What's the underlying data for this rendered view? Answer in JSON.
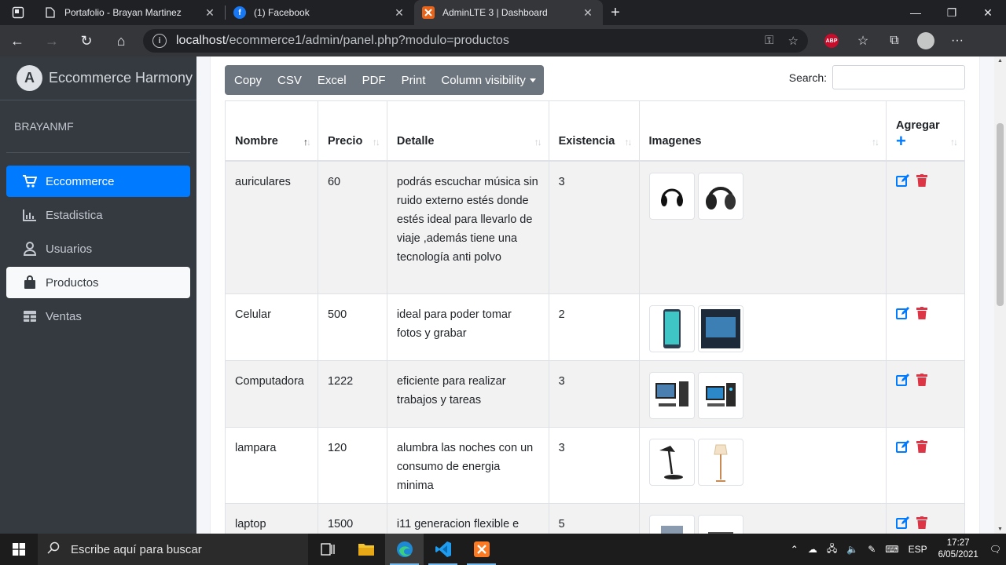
{
  "browser": {
    "tabs": [
      {
        "title": "Portafolio - Brayan Martinez",
        "active": false
      },
      {
        "title": "(1) Facebook",
        "active": false
      },
      {
        "title": "AdminLTE 3 | Dashboard",
        "active": true
      }
    ],
    "url_host": "localhost",
    "url_path": "/ecommerce1/admin/panel.php?modulo=productos",
    "abp_label": "ABP"
  },
  "sidebar": {
    "brand": "Eccommerce Harmony",
    "user": "BRAYANMF",
    "items": [
      {
        "label": "Eccommerce",
        "icon": "cart-icon",
        "state": "primary"
      },
      {
        "label": "Estadistica",
        "icon": "chart-icon",
        "state": "normal"
      },
      {
        "label": "Usuarios",
        "icon": "user-icon",
        "state": "normal"
      },
      {
        "label": "Productos",
        "icon": "bag-icon",
        "state": "light"
      },
      {
        "label": "Ventas",
        "icon": "table-icon",
        "state": "normal"
      }
    ]
  },
  "toolbar": {
    "buttons": [
      "Copy",
      "CSV",
      "Excel",
      "PDF",
      "Print",
      "Column visibility"
    ],
    "search_label": "Search:"
  },
  "table": {
    "headers": [
      "Nombre",
      "Precio",
      "Detalle",
      "Existencia",
      "Imagenes",
      "Agregar"
    ],
    "rows": [
      {
        "nombre": "auriculares",
        "precio": "60",
        "detalle": "podrás escuchar música sin ruido externo estés donde estés ideal para llevarlo de viaje ,además tiene una tecnología anti polvo",
        "existencia": "3",
        "images": [
          "headphones-image",
          "headphones-image"
        ]
      },
      {
        "nombre": "Celular",
        "precio": "500",
        "detalle": "ideal para poder tomar fotos y grabar",
        "existencia": "2",
        "images": [
          "phone-image",
          "tablet-image"
        ]
      },
      {
        "nombre": "Computadora",
        "precio": "1222",
        "detalle": "eficiente para realizar trabajos y tareas",
        "existencia": "3",
        "images": [
          "computer-image",
          "computer-image"
        ]
      },
      {
        "nombre": "lampara",
        "precio": "120",
        "detalle": "alumbra las noches con un consumo de energia minima",
        "existencia": "3",
        "images": [
          "desk-lamp-image",
          "floor-lamp-image"
        ]
      },
      {
        "nombre": "laptop",
        "precio": "1500",
        "detalle": "i11 generacion flexible e",
        "existencia": "5",
        "images": [
          "laptop-image",
          "laptop-image"
        ]
      }
    ]
  },
  "taskbar": {
    "search_placeholder": "Escribe aquí para buscar",
    "lang": "ESP",
    "time": "17:27",
    "date": "6/05/2021"
  },
  "colors": {
    "primary": "#007bff",
    "danger": "#dc3545",
    "sidebar": "#343a40",
    "buttons": "#6c757d"
  }
}
